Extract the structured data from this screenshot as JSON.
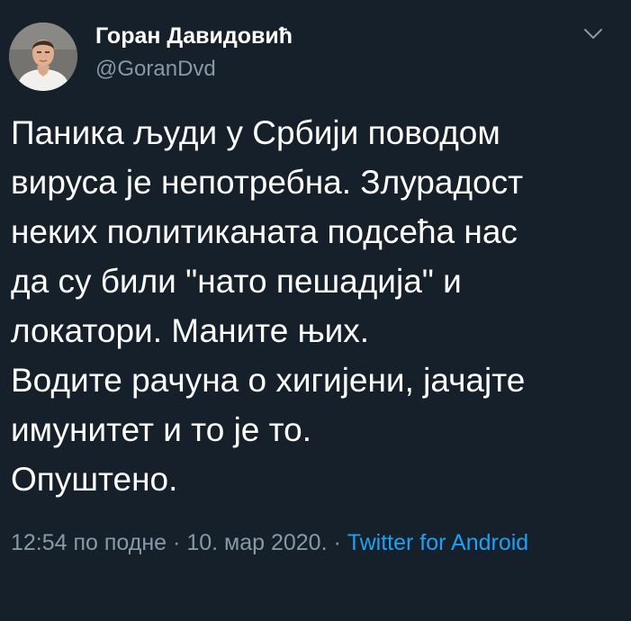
{
  "author": {
    "display_name": "Горан Давидовић",
    "handle": "@GoranDvd"
  },
  "tweet": {
    "lines": [
      "Паника људи у Србији поводом",
      "вируса је непотребна. Злурадост",
      "неких политиканата подсећа нас",
      "да су били \"нато пешадија\" и",
      "локатори. Маните њих.",
      "Водите рачуна о хигијени, јачајте",
      "имунитет и то је то.",
      "Опуштено."
    ]
  },
  "meta": {
    "time": "12:54 по подне",
    "separator": " · ",
    "date": "10. мар 2020.",
    "separator2": " · ",
    "source": "Twitter for Android"
  },
  "icons": {
    "menu": "chevron-down-icon"
  },
  "colors": {
    "background": "#15202b",
    "text": "#ffffff",
    "secondary_text": "#8899a6",
    "link": "#1da1f2"
  }
}
